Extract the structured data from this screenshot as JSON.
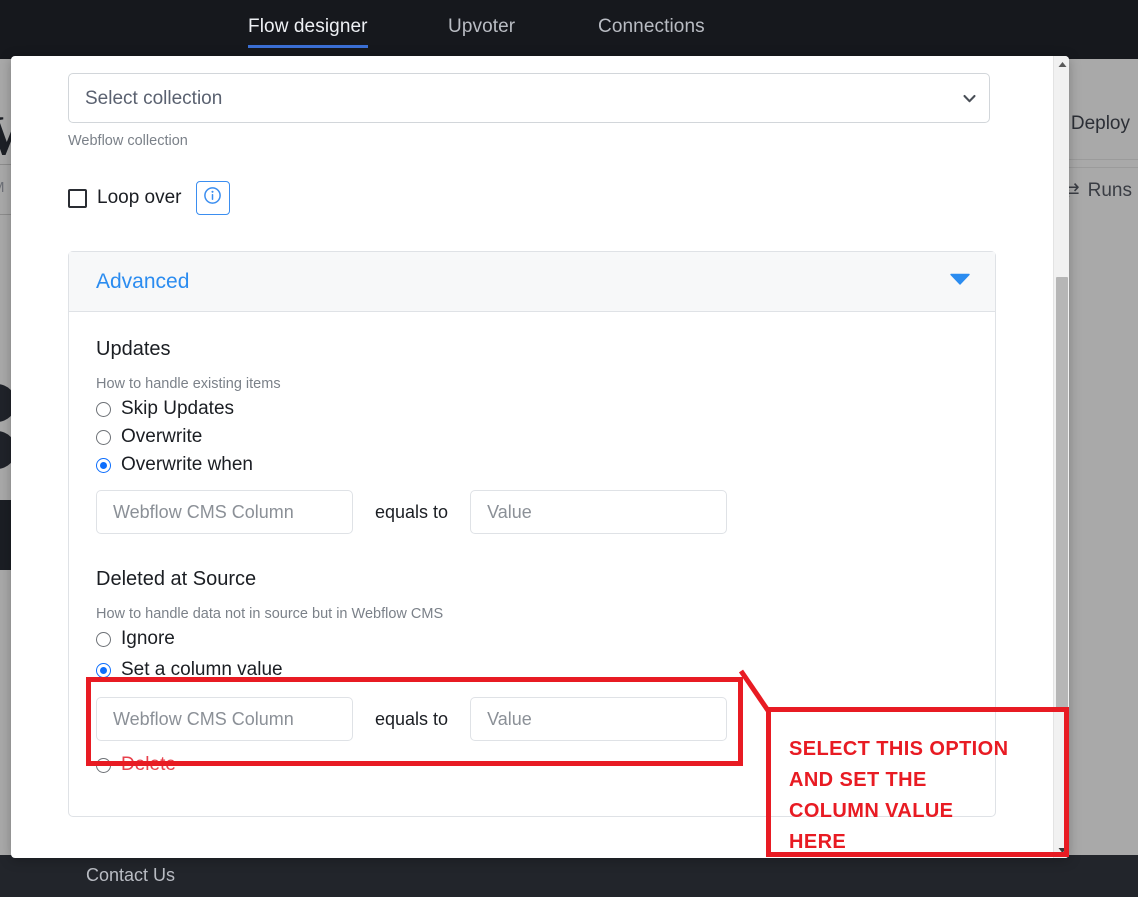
{
  "topnav": {
    "tabs": [
      {
        "label": "Flow designer",
        "active": true
      },
      {
        "label": "Upvoter",
        "active": false
      },
      {
        "label": "Connections",
        "active": false
      }
    ],
    "accent_color": "#3b6fd4"
  },
  "background": {
    "logo_glyph": "W",
    "menu_glyph": "M",
    "deploy_label": "Deploy",
    "runs_label": "Runs",
    "runs_icon": "swap-arrows-icon",
    "deploy_icon": "rocket-icon"
  },
  "footer": {
    "contact_label": "Contact Us"
  },
  "modal": {
    "collection_select": {
      "selected": "Select collection",
      "options": [
        "Select collection"
      ],
      "helper": "Webflow collection",
      "chevron_icon": "chevron-down-icon"
    },
    "loop_over": {
      "label": "Loop over",
      "checked": false,
      "info_icon": "info-circle-icon"
    },
    "advanced": {
      "title": "Advanced",
      "expanded": true,
      "toggle_icon": "triangle-down-icon",
      "updates": {
        "heading": "Updates",
        "hint": "How to handle existing items",
        "options": [
          {
            "label": "Skip Updates",
            "selected": false
          },
          {
            "label": "Overwrite",
            "selected": false
          },
          {
            "label": "Overwrite when",
            "selected": true
          }
        ],
        "column_placeholder": "Webflow CMS Column",
        "column_value": "",
        "equals_label": "equals to",
        "value_placeholder": "Value",
        "value_value": ""
      },
      "deleted_at_source": {
        "heading": "Deleted at Source",
        "hint": "How to handle data not in source but in Webflow CMS",
        "options": [
          {
            "label": "Ignore",
            "selected": false,
            "danger": false
          },
          {
            "label": "Set a column value",
            "selected": true,
            "danger": false
          },
          {
            "label": "Delete",
            "selected": false,
            "danger": true
          }
        ],
        "column_placeholder": "Webflow CMS Column",
        "column_value": "",
        "equals_label": "equals to",
        "value_placeholder": "Value",
        "value_value": ""
      }
    },
    "scrollbar": {
      "up_icon": "scroll-up-arrow-icon",
      "down_icon": "scroll-down-arrow-icon"
    }
  },
  "annotation": {
    "color": "#e81b23",
    "lines": [
      "SELECT THIS OPTION",
      "AND SET THE",
      "COLUMN VALUE",
      "HERE"
    ]
  }
}
